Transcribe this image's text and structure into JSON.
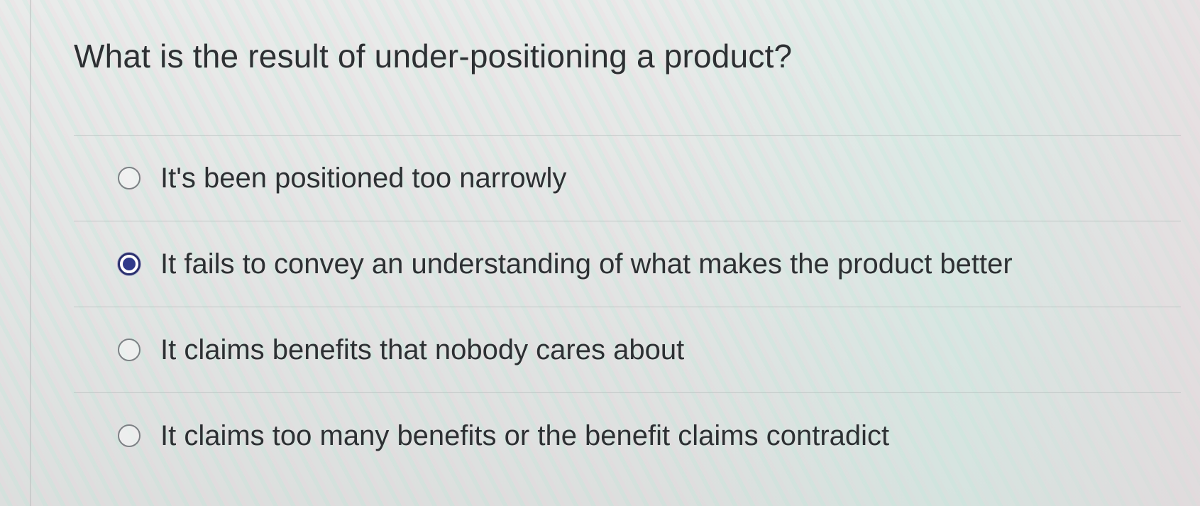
{
  "question": {
    "title": "What is the result of under-positioning a product?"
  },
  "answers": [
    {
      "label": "It's been positioned too narrowly",
      "selected": false
    },
    {
      "label": "It fails to convey an understanding of what makes the product better",
      "selected": true
    },
    {
      "label": "It claims benefits that nobody cares about",
      "selected": false
    },
    {
      "label": "It claims too many benefits or the benefit claims contradict",
      "selected": false
    }
  ],
  "colors": {
    "text": "#2d3033",
    "radio_selected": "#303a8a",
    "radio_border": "#7d8185"
  }
}
